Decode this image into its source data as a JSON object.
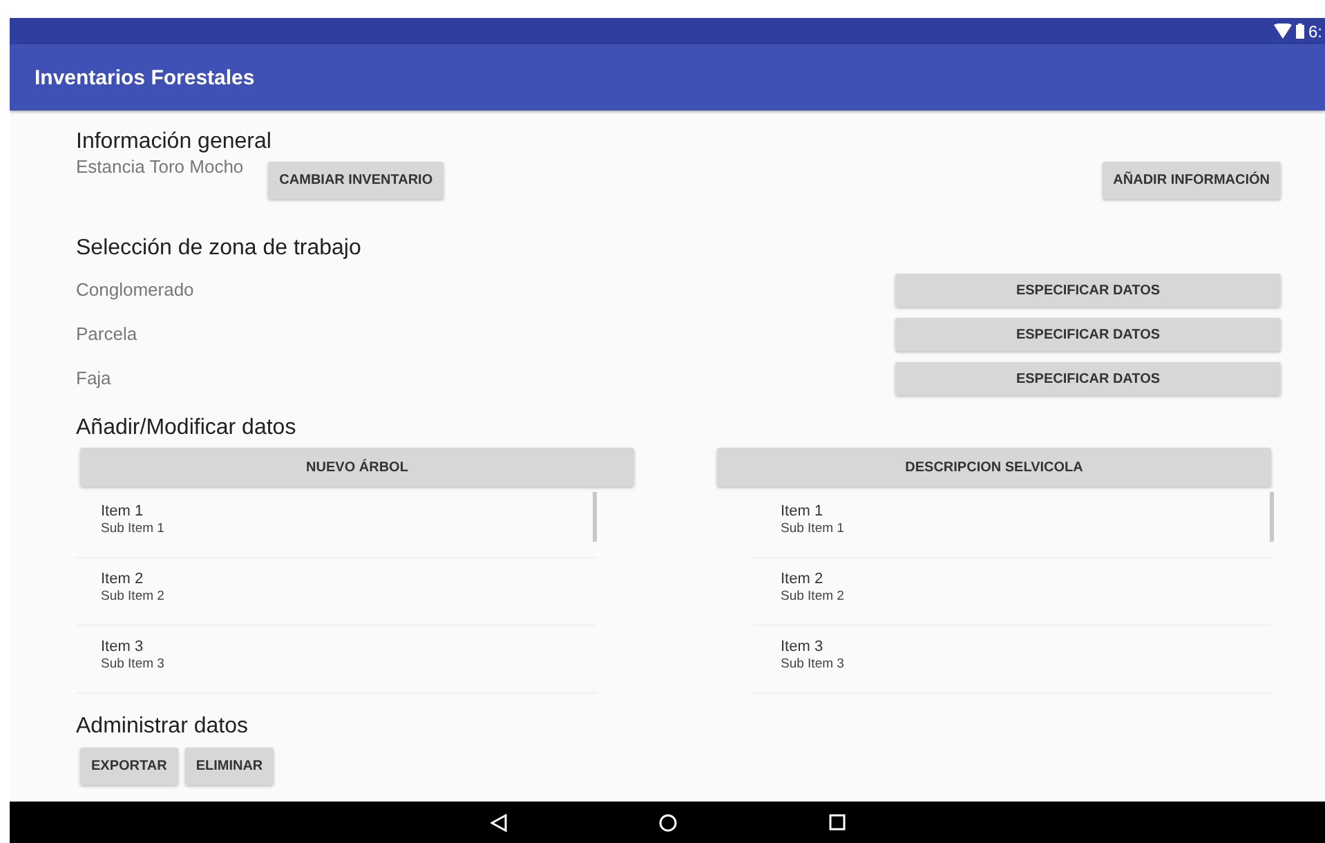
{
  "status_bar": {
    "time": "6:"
  },
  "app_bar": {
    "title": "Inventarios Forestales"
  },
  "general": {
    "heading": "Información general",
    "inventory": "Estancia Toro Mocho",
    "change_button": "CAMBIAR INVENTARIO",
    "add_button": "AÑADIR INFORMACIÓN"
  },
  "zone": {
    "heading": "Selección de zona de trabajo",
    "rows": [
      {
        "label": "Conglomerado",
        "button": "ESPECIFICAR DATOS"
      },
      {
        "label": "Parcela",
        "button": "ESPECIFICAR DATOS"
      },
      {
        "label": "Faja",
        "button": "ESPECIFICAR DATOS"
      }
    ]
  },
  "modify": {
    "heading": "Añadir/Modificar datos",
    "lists": [
      {
        "button": "NUEVO ÁRBOL",
        "items": [
          {
            "title": "Item 1",
            "subtitle": "Sub Item 1"
          },
          {
            "title": "Item 2",
            "subtitle": "Sub Item 2"
          },
          {
            "title": "Item 3",
            "subtitle": "Sub Item 3"
          }
        ]
      },
      {
        "button": "DESCRIPCION SELVICOLA",
        "items": [
          {
            "title": "Item 1",
            "subtitle": "Sub Item 1"
          },
          {
            "title": "Item 2",
            "subtitle": "Sub Item 2"
          },
          {
            "title": "Item 3",
            "subtitle": "Sub Item 3"
          }
        ]
      }
    ]
  },
  "manage": {
    "heading": "Administrar datos",
    "buttons": [
      "EXPORTAR",
      "ELIMINAR"
    ]
  }
}
